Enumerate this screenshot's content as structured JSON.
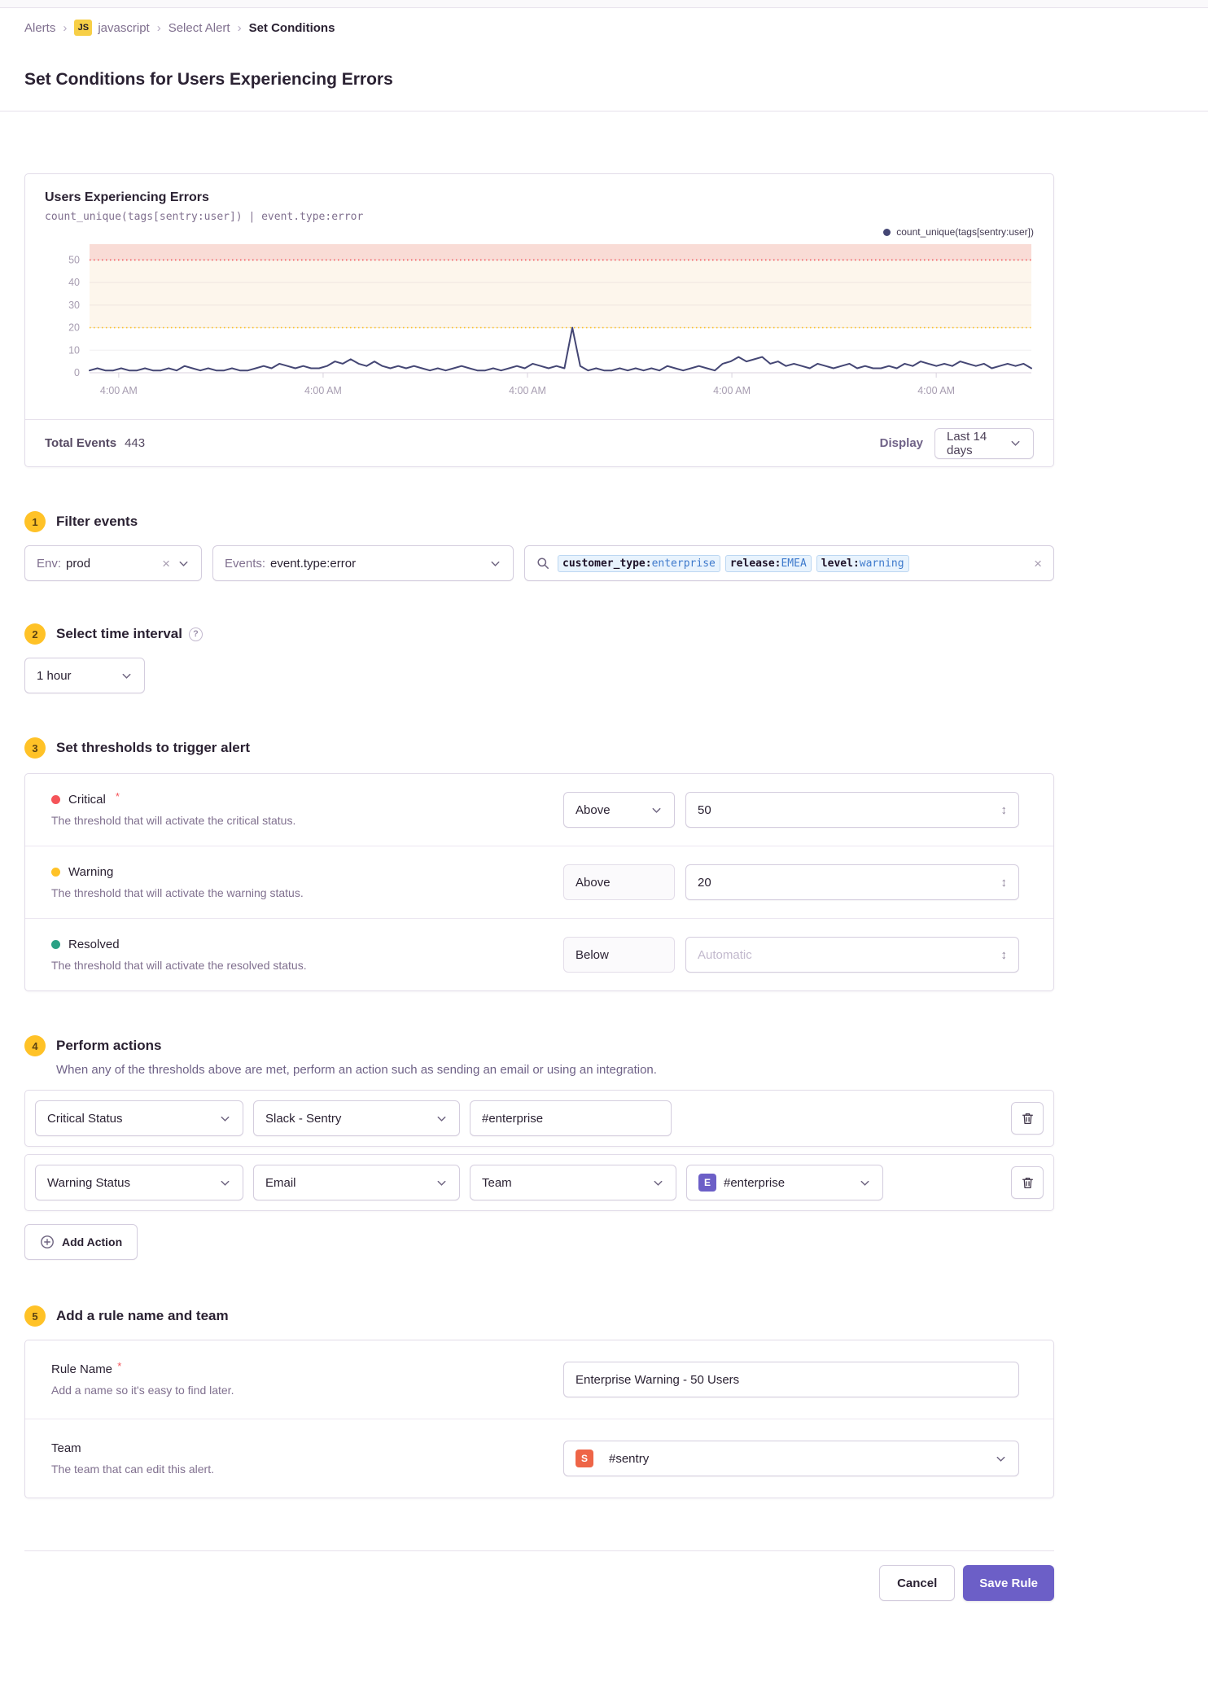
{
  "theme": {
    "accent_purple": "#6c5fc7",
    "step_badge_bg": "#ffc227",
    "js_badge_yellow": "#f7cf46",
    "critical_red": "#f55459",
    "warning_yellow": "#ffc227",
    "resolved_teal": "#2ba185",
    "series_purple": "#444674",
    "team_badge_orange": "#ee6547"
  },
  "breadcrumb": {
    "alerts": "Alerts",
    "project_badge": "JS",
    "project": "javascript",
    "select_alert": "Select Alert",
    "current": "Set Conditions"
  },
  "page_title": "Set Conditions for Users Experiencing Errors",
  "chart_card": {
    "title": "Users Experiencing Errors",
    "query": "count_unique(tags[sentry:user]) | event.type:error",
    "legend_label": "count_unique(tags[sentry:user])",
    "total_events_label": "Total Events",
    "total_events_value": "443",
    "display_label": "Display",
    "display_value": "Last 14 days"
  },
  "chart_data": {
    "type": "line",
    "title": "Users Experiencing Errors",
    "ylabel": "count_unique(tags[sentry:user])",
    "y_ticks": [
      0,
      10,
      20,
      30,
      40,
      50
    ],
    "ylim": [
      0,
      57
    ],
    "x_tick_labels": [
      "4:00 AM",
      "4:00 AM",
      "4:00 AM",
      "4:00 AM",
      "4:00 AM"
    ],
    "x_tick_fractions": [
      0.031,
      0.248,
      0.465,
      0.682,
      0.899
    ],
    "thresholds": {
      "critical_above": 50,
      "warning_above": 20
    },
    "legend_position": "top-right",
    "grid": true,
    "series": [
      {
        "name": "count_unique(tags[sentry:user])",
        "values": [
          1,
          2,
          1,
          1,
          2,
          1,
          1,
          2,
          1,
          1,
          2,
          1,
          3,
          2,
          1,
          2,
          1,
          1,
          2,
          1,
          1,
          2,
          3,
          2,
          4,
          3,
          2,
          3,
          2,
          2,
          3,
          5,
          4,
          6,
          4,
          3,
          5,
          3,
          2,
          3,
          2,
          3,
          2,
          1,
          2,
          1,
          2,
          3,
          2,
          1,
          1,
          2,
          1,
          2,
          3,
          2,
          4,
          3,
          2,
          3,
          2,
          20,
          3,
          1,
          2,
          1,
          1,
          2,
          1,
          2,
          1,
          2,
          1,
          3,
          2,
          1,
          2,
          3,
          2,
          1,
          4,
          5,
          7,
          5,
          6,
          7,
          4,
          5,
          3,
          4,
          3,
          2,
          4,
          3,
          2,
          3,
          4,
          2,
          3,
          2,
          2,
          3,
          2,
          4,
          3,
          5,
          4,
          3,
          4,
          3,
          5,
          4,
          3,
          4,
          2,
          3,
          4,
          3,
          4,
          2
        ]
      }
    ],
    "colors": {
      "line": "#444674",
      "critical_band": "#f9dcd6",
      "critical_line": "#f55459",
      "warning_band": "#fdf6ec",
      "warning_line": "#ffc227"
    }
  },
  "filter_section": {
    "step": "1",
    "title": "Filter events",
    "env": {
      "label": "Env:",
      "value": "prod"
    },
    "events": {
      "label": "Events:",
      "value": "event.type:error"
    },
    "search_tokens": [
      {
        "key": "customer_type",
        "value": "enterprise"
      },
      {
        "key": "release",
        "value": "EMEA"
      },
      {
        "key": "level",
        "value": "warning"
      }
    ]
  },
  "interval_section": {
    "step": "2",
    "title": "Select time interval",
    "value": "1 hour"
  },
  "threshold_section": {
    "step": "3",
    "title": "Set thresholds to trigger alert",
    "rows": [
      {
        "name": "Critical",
        "description": "The threshold that will activate the critical status.",
        "comparison": "Above",
        "value": "50",
        "placeholder": ""
      },
      {
        "name": "Warning",
        "description": "The threshold that will activate the warning status.",
        "comparison": "Above",
        "value": "20",
        "placeholder": ""
      },
      {
        "name": "Resolved",
        "description": "The threshold that will activate the resolved status.",
        "comparison": "Below",
        "value": "",
        "placeholder": "Automatic"
      }
    ]
  },
  "actions_section": {
    "step": "4",
    "title": "Perform actions",
    "description": "When any of the thresholds above are met, perform an action such as sending an email or using an integration.",
    "row1": {
      "trigger": "Critical Status",
      "service": "Slack - Sentry",
      "target": "#enterprise"
    },
    "row2": {
      "trigger": "Warning Status",
      "service": "Email",
      "target_type": "Team",
      "target_badge": "E",
      "target": "#enterprise"
    },
    "add_action": "Add Action"
  },
  "rule_section": {
    "step": "5",
    "title": "Add a rule name and team",
    "rule_name": {
      "label": "Rule Name",
      "description": "Add a name so it's easy to find later.",
      "value": "Enterprise Warning - 50 Users"
    },
    "team": {
      "label": "Team",
      "description": "The team that can edit this alert.",
      "badge": "S",
      "value": "#sentry"
    }
  },
  "footer": {
    "cancel": "Cancel",
    "save": "Save Rule"
  }
}
